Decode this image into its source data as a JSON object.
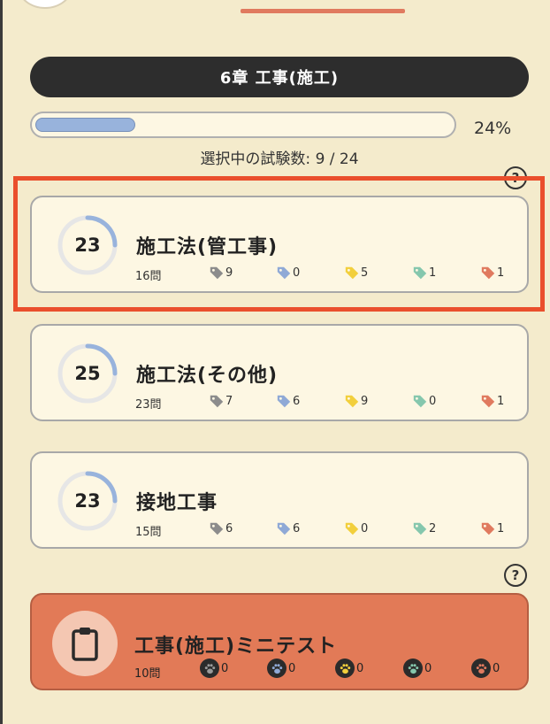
{
  "chapter": {
    "title": "6章 工事(施工)"
  },
  "progress": {
    "fraction": 0.24,
    "percent_label": "24%"
  },
  "selection": {
    "text": "選択中の試験数: 9 / 24"
  },
  "help": {
    "symbol": "?"
  },
  "colors": {
    "tag_gray": "#8c8c8c",
    "tag_blue": "#8fa9d6",
    "tag_yellow": "#f2cf3c",
    "tag_green": "#85c7ad",
    "tag_red": "#e07a5f",
    "ring_progress": "#98b3dc",
    "ring_track": "#e6e6e6"
  },
  "cards": [
    {
      "number": "23",
      "ring_progress": 0.25,
      "title": "施工法(管工事)",
      "count": "16問",
      "tags": [
        "9",
        "0",
        "5",
        "1",
        "1"
      ]
    },
    {
      "number": "25",
      "ring_progress": 0.25,
      "title": "施工法(その他)",
      "count": "23問",
      "tags": [
        "7",
        "6",
        "9",
        "0",
        "1"
      ]
    },
    {
      "number": "23",
      "ring_progress": 0.25,
      "title": "接地工事",
      "count": "15問",
      "tags": [
        "6",
        "6",
        "0",
        "2",
        "1"
      ]
    }
  ],
  "minitest": {
    "icon": "clipboard-icon",
    "title": "工事(施工)ミニテスト",
    "count": "10問",
    "paws": [
      "0",
      "0",
      "0",
      "0",
      "0"
    ]
  }
}
